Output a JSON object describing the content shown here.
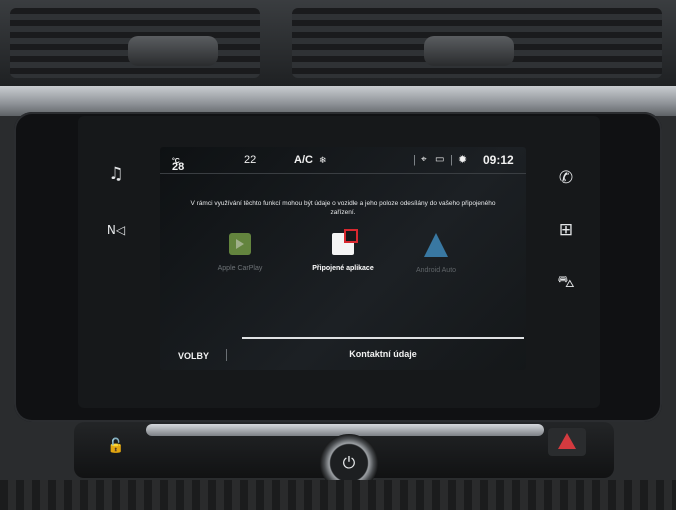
{
  "side_controls": {
    "music_icon": "♫",
    "nav_icon": "N◁",
    "phone_icon": "✆",
    "apps_icon": "⊞",
    "car_icon": "⛍"
  },
  "status_bar": {
    "temperature": "28",
    "temperature_unit": "°C",
    "fan_level": "22",
    "ac_label": "A/C",
    "ac_icon": "❄",
    "separator": "|",
    "location_icon": "⌖",
    "message_icon": "▭",
    "settings_icon": "✹",
    "clock": "09:12"
  },
  "notice": {
    "text": "V rámci využívání těchto funkcí mohou být údaje o vozidle a jeho poloze odesílány do vašeho připojeného zařízení."
  },
  "apps": [
    {
      "label": "Apple CarPlay"
    },
    {
      "label": "Připojené aplikace"
    },
    {
      "label": "Android Auto"
    }
  ],
  "bottom_bar": {
    "options_label": "VOLBY",
    "contact_label": "Kontaktní údaje"
  },
  "console": {
    "lock_icon": "🔓",
    "power_icon": "⏻"
  },
  "colors": {
    "accent_red": "#d8282f",
    "carplay_green": "#7ea84a",
    "android_blue": "#3e88b8"
  }
}
